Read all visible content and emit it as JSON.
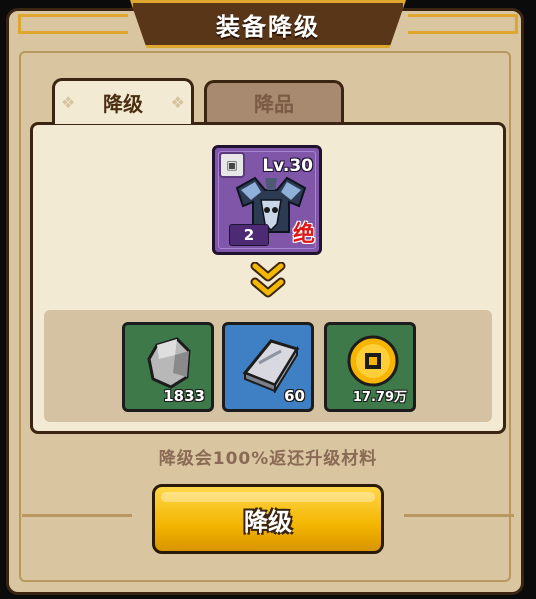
{
  "window": {
    "title": "装备降级"
  },
  "tabs": [
    {
      "label": "降级",
      "active": true
    },
    {
      "label": "降品",
      "active": false
    }
  ],
  "item": {
    "level_text": "Lv.30",
    "grade": "2",
    "quality_char": "绝",
    "icon": "armor-icon",
    "slot_icon": "cloth-icon",
    "card_color": "#7f56a8"
  },
  "materials": [
    {
      "icon": "stone-icon",
      "count": "1833",
      "bg": "#3e7a49"
    },
    {
      "icon": "silver-ingot-icon",
      "count": "60",
      "bg": "#3f7fc4"
    },
    {
      "icon": "gold-coin-icon",
      "count": "17.79万",
      "bg": "#3e7a49"
    }
  ],
  "description": "降级会100%返还升级材料",
  "action_button": {
    "label": "降级"
  },
  "colors": {
    "accent": "#f3b500",
    "panel": "#d9c6a0",
    "title_bar": "#5a3618"
  }
}
